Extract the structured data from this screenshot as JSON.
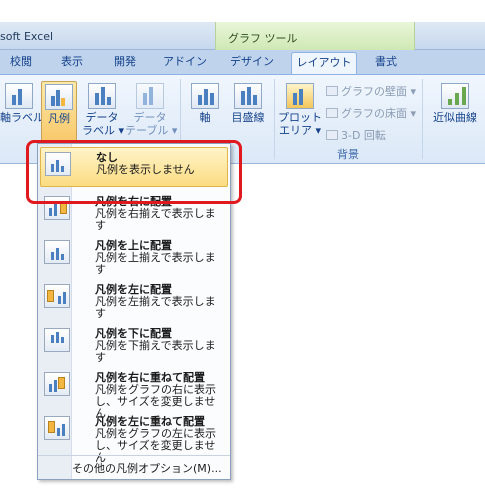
{
  "window": {
    "app_title": "soft Excel",
    "context_title": "グラフ ツール"
  },
  "tabs": [
    "校閲",
    "表示",
    "開発",
    "アドイン",
    "デザイン",
    "レイアウト",
    "書式"
  ],
  "active_tab": "レイアウト",
  "ribbon": {
    "axis_label_btn": "軸ラベル",
    "legend_btn": "凡例",
    "data_label_btn": "データ\nラベル ▾",
    "data_table_btn": "データ\nテーブル ▾",
    "axis_btn": "軸",
    "gridlines_btn": "目盛線",
    "plot_area_btn": "プロット\nエリア ▾",
    "chart_wall": "グラフの壁面 ▾",
    "chart_floor": "グラフの床面 ▾",
    "rotation_3d": "3-D 回転",
    "trendline_btn": "近似曲線",
    "group_background": "背景"
  },
  "menu": {
    "items": [
      {
        "title": "なし",
        "desc": "凡例を表示しません"
      },
      {
        "title": "凡例を右に配置",
        "desc": "凡例を右揃えで表示します"
      },
      {
        "title": "凡例を上に配置",
        "desc": "凡例を上揃えで表示します"
      },
      {
        "title": "凡例を左に配置",
        "desc": "凡例を左揃えで表示します"
      },
      {
        "title": "凡例を下に配置",
        "desc": "凡例を下揃えで表示します"
      },
      {
        "title": "凡例を右に重ねて配置",
        "desc": "凡例をグラフの右に表示し、サイズを変更しません"
      },
      {
        "title": "凡例を左に重ねて配置",
        "desc": "凡例をグラフの左に表示し、サイズを変更しません"
      }
    ],
    "more_options": "その他の凡例オプション(M)..."
  },
  "colors": {
    "highlight": "#fbdc82",
    "annotation": "#e0191f",
    "ribbon_text": "#15428b"
  }
}
